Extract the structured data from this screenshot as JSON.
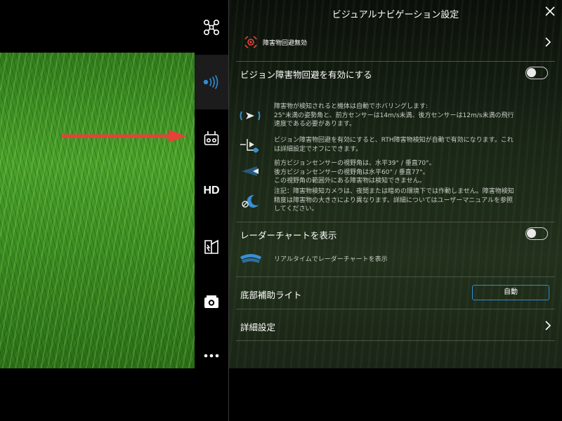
{
  "header": {
    "title": "ビジュアルナビゲーション設定"
  },
  "status": {
    "text": "障害物回避無効"
  },
  "obstacle_avoidance": {
    "label": "ビジョン障害物回避を有効にする",
    "enabled": false,
    "descriptions": [
      {
        "icon": "radar-sensor-icon",
        "lines": [
          "障害物が検知されると機体は自動でホバリングします:",
          "25°未満の姿勢角と、前方センサーは14m/s未満、後方センサーは12m/s未満の飛行",
          "速度である必要があります。"
        ]
      },
      {
        "icon": "rth-obstacle-icon",
        "lines": [
          "ビジョン障害物回避を有効にすると、RTH障害物検知が自動で有効になります。これ",
          "は詳細設定でオフにできます。"
        ]
      },
      {
        "icon": "vision-angle-icon",
        "lines": [
          "前方ビジョンセンサーの視野角は、水平39° / 垂直70°。",
          "後方ビジョンセンサーの視野角は水平60° / 垂直77°。",
          "この視野角の範囲外にある障害物は検知できません。"
        ]
      },
      {
        "icon": "night-warning-icon",
        "lines": [
          "注記：障害物検知カメラは、夜間または暗めの環境下では作動しません。障害物検知",
          "精度は障害物の大きさにより異なります。詳細についてはユーザーマニュアルを参照",
          "してください。"
        ]
      }
    ]
  },
  "radar_chart": {
    "label": "レーダーチャートを表示",
    "enabled": false,
    "description": "リアルタイムでレーダーチャートを表示"
  },
  "bottom_light": {
    "label": "底部補助ライト",
    "button": "自動"
  },
  "advanced": {
    "label": "詳細設定"
  },
  "sidebar": {
    "items": [
      {
        "name": "drone-icon"
      },
      {
        "name": "vision-sensor-icon",
        "active": true
      },
      {
        "name": "remote-controller-icon"
      },
      {
        "name": "hd-transmission-icon",
        "text": "HD"
      },
      {
        "name": "battery-icon"
      },
      {
        "name": "camera-icon"
      },
      {
        "name": "more-icon"
      }
    ]
  },
  "colors": {
    "accent": "#2f8fd6",
    "warning": "#e8413a",
    "arrow": "#e8413a"
  }
}
